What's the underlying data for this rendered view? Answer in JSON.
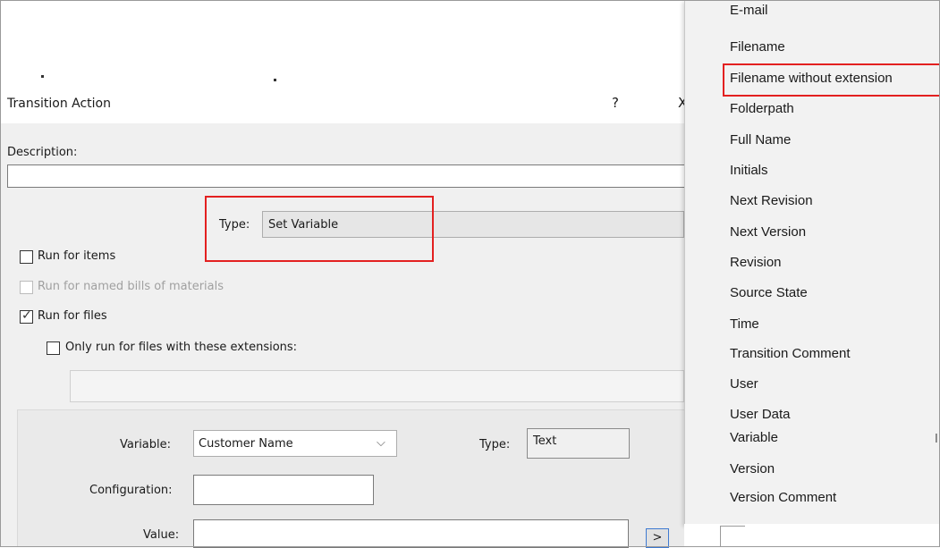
{
  "dialog": {
    "title": "Transition Action",
    "help_glyph": "?",
    "close_glyph": "X",
    "description_label": "Description:",
    "description_value": "",
    "type_label": "Type:",
    "type_value": "Set Variable",
    "run_items": {
      "label": "Run for items",
      "checked": false
    },
    "run_boms": {
      "label": "Run for named bills of materials",
      "checked": false,
      "disabled": true
    },
    "run_files": {
      "label": "Run for files",
      "checked": true
    },
    "only_ext": {
      "label": "Only run for files with these extensions:",
      "checked": false
    },
    "extensions_value": "",
    "variable_label": "Variable:",
    "variable_value": "Customer Name",
    "var_type_label": "Type:",
    "var_type_value": "Text",
    "configuration_label": "Configuration:",
    "configuration_value": "",
    "value_label": "Value:",
    "value_value": "",
    "browse_label": ">"
  },
  "menu": {
    "items": [
      "E-mail",
      "Filename",
      "Filename without extension",
      "Folderpath",
      "Full Name",
      "Initials",
      "Next Revision",
      "Next Version",
      "Revision",
      "Source State",
      "Time",
      "Transition Comment",
      "User",
      "User Data",
      "Variable",
      "Version",
      "Version Comment"
    ],
    "highlighted_item": "Filename without extension",
    "stray_glyph": "I"
  },
  "colors": {
    "highlight": "#e32020",
    "dialog_bg": "#f0f0f0",
    "menu_bg": "#f2f2f2",
    "button_border": "#3e7ad1"
  }
}
